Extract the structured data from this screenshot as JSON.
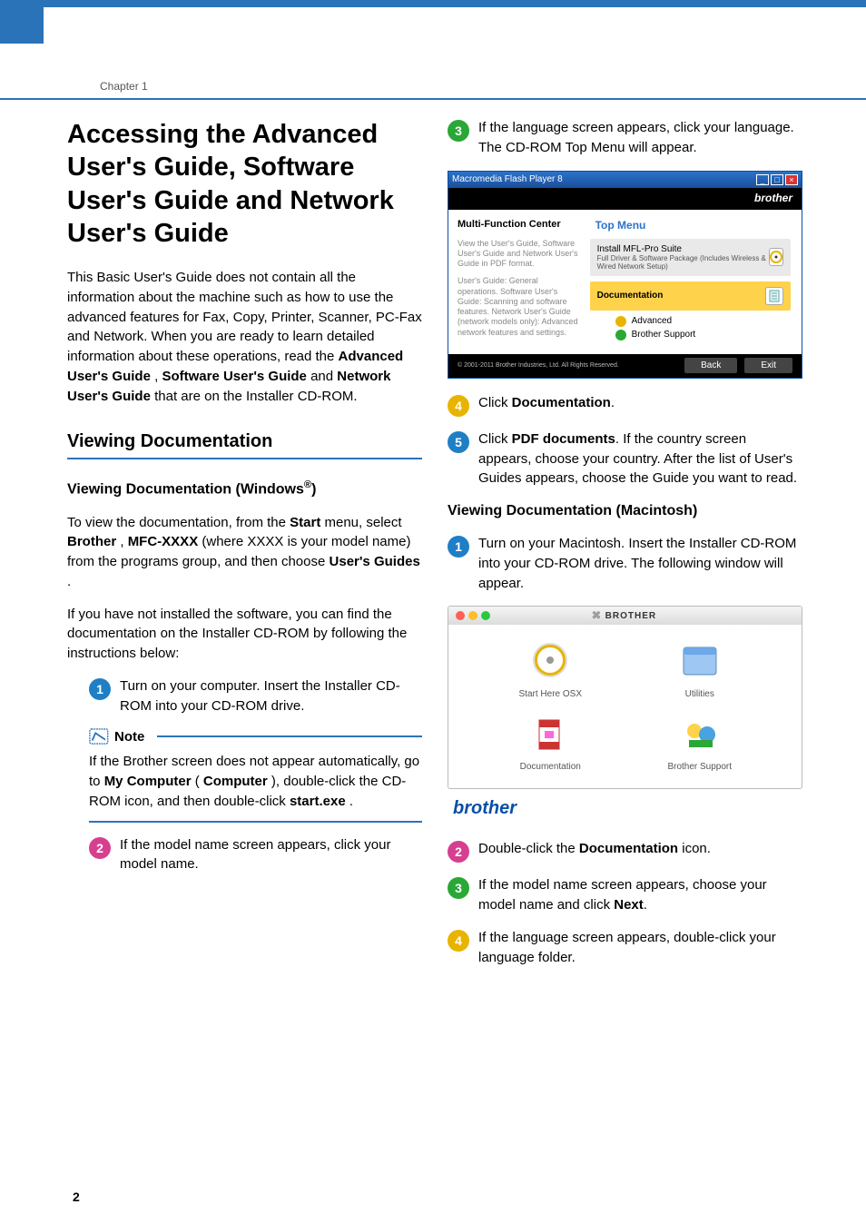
{
  "chapter_label": "Chapter 1",
  "main_title": "Accessing the Advanced User's Guide, Software User's Guide and Network User's Guide",
  "intro_p1_a": "This Basic User's Guide does not contain all the information about the machine such as how to use the advanced features for Fax, Copy, Printer, Scanner, PC-Fax and Network. When you are ready to learn detailed information about these operations, read the ",
  "intro_b1": "Advanced User's Guide",
  "intro_p1_b": ", ",
  "intro_b2": "Software User's Guide",
  "intro_p1_c": " and ",
  "intro_b3": "Network User's Guide",
  "intro_p1_d": " that are on the Installer CD-ROM.",
  "h2_viewing": "Viewing Documentation",
  "h3_windows_a": "Viewing Documentation (Windows",
  "h3_windows_sup": "®",
  "h3_windows_b": ")",
  "win_p1_a": "To view the documentation, from the ",
  "win_b_start": "Start",
  "win_p1_b": " menu, select ",
  "win_b_brother": "Brother",
  "win_p1_c": ", ",
  "win_b_mfc": "MFC-XXXX",
  "win_p1_d": " (where XXXX is your model name) from the programs group, and then choose ",
  "win_b_ug": "User's Guides",
  "win_p1_e": ".",
  "win_p2": "If you have not installed the software, you can find the documentation on the Installer CD-ROM by following the instructions below:",
  "steps_win": {
    "1": "Turn on your computer. Insert the Installer CD-ROM into your CD-ROM drive.",
    "2": "If the model name screen appears, click your model name.",
    "3": "If the language screen appears, click your language. The CD-ROM Top Menu will appear."
  },
  "note_title": "Note",
  "note_body_a": "If the Brother screen does not appear automatically, go to ",
  "note_b1": "My Computer",
  "note_body_b": " (",
  "note_b2": "Computer",
  "note_body_c": "), double-click the CD-ROM icon, and then double-click ",
  "note_b3": "start.exe",
  "note_body_d": ".",
  "topmenu": {
    "title": "Macromedia Flash Player 8",
    "brand": "brother",
    "mfc": "Multi-Function Center",
    "left1": "View the User's Guide, Software User's Guide and Network User's Guide in PDF format.",
    "left2": "User's Guide: General operations. Software User's Guide: Scanning and software features. Network User's Guide (network models only): Advanced network features and settings.",
    "header": "Top Menu",
    "item1": "Install MFL-Pro Suite",
    "item1_sub": "Full Driver & Software Package (Includes Wireless & Wired Network Setup)",
    "item2": "Documentation",
    "item3": "Advanced",
    "item4": "Brother Support",
    "back": "Back",
    "exit": "Exit",
    "copy": "© 2001-2011 Brother Industries, Ltd. All Rights Reserved."
  },
  "step4_a": "Click ",
  "step4_b": "Documentation",
  "step4_c": ".",
  "step5_a": "Click ",
  "step5_b": "PDF documents",
  "step5_c": ". If the country screen appears, choose your country. After the list of User's Guides appears, choose the Guide you want to read.",
  "h3_mac": "Viewing Documentation (Macintosh)",
  "mac_step1": "Turn on your Macintosh. Insert the Installer CD-ROM into your CD-ROM drive. The following window will appear.",
  "mac_win": {
    "title": "BROTHER",
    "icons": {
      "start": "Start Here OSX",
      "util": "Utilities",
      "doc": "Documentation",
      "sup": "Brother Support"
    }
  },
  "brand_lower": "brother",
  "mac_step2_a": "Double-click the ",
  "mac_step2_b": "Documentation",
  "mac_step2_c": " icon.",
  "mac_step3_a": "If the model name screen appears, choose your model name and click ",
  "mac_step3_b": "Next",
  "mac_step3_c": ".",
  "mac_step4": "If the language screen appears, double-click your language folder.",
  "page_number": "2"
}
